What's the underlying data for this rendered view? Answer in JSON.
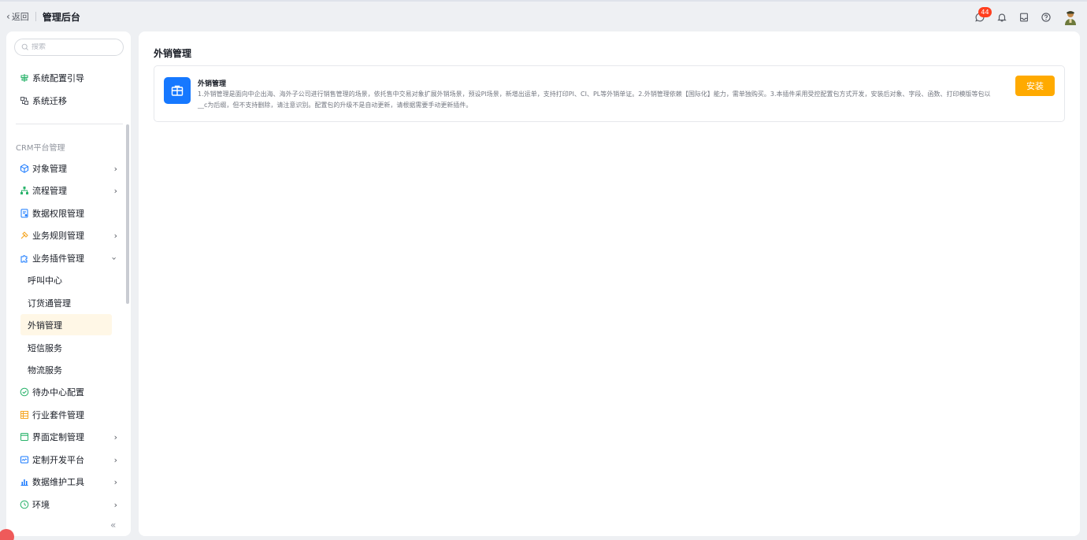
{
  "topbar": {
    "back_label": "返回",
    "title": "管理后台",
    "notification_count": "44",
    "icons": [
      "chat-icon",
      "bell-icon",
      "inbox-icon",
      "help-icon",
      "avatar"
    ]
  },
  "sidebar": {
    "search_placeholder": "搜索",
    "top_items": [
      {
        "label": "系统配置引导",
        "icon": "guide-icon"
      },
      {
        "label": "系统迁移",
        "icon": "migrate-icon"
      }
    ],
    "section_title": "CRM平台管理",
    "items": [
      {
        "label": "对象管理",
        "icon": "object-icon",
        "has_arrow": true
      },
      {
        "label": "流程管理",
        "icon": "flow-icon",
        "has_arrow": true
      },
      {
        "label": "数据权限管理",
        "icon": "data-permission-icon",
        "has_arrow": false
      },
      {
        "label": "业务规则管理",
        "icon": "rule-icon",
        "has_arrow": true
      },
      {
        "label": "业务插件管理",
        "icon": "plugin-icon",
        "has_arrow": true,
        "expanded": true
      }
    ],
    "sub_items": [
      {
        "label": "呼叫中心"
      },
      {
        "label": "订货通管理"
      },
      {
        "label": "外销管理",
        "active": true
      },
      {
        "label": "短信服务"
      },
      {
        "label": "物流服务"
      }
    ],
    "bottom_items": [
      {
        "label": "待办中心配置",
        "icon": "todo-icon",
        "has_arrow": false
      },
      {
        "label": "行业套件管理",
        "icon": "suite-icon",
        "has_arrow": false
      },
      {
        "label": "界面定制管理",
        "icon": "ui-custom-icon",
        "has_arrow": true
      },
      {
        "label": "定制开发平台",
        "icon": "dev-platform-icon",
        "has_arrow": true
      },
      {
        "label": "数据维护工具",
        "icon": "data-tool-icon",
        "has_arrow": true
      },
      {
        "label": "环境",
        "icon": "environment-icon",
        "has_arrow": true
      }
    ],
    "collapse_label": "«"
  },
  "main": {
    "title": "外销管理",
    "card": {
      "title": "外销管理",
      "description": "1.外销管理是面向中企出海、海外子公司进行销售管理的场景，依托售中交易对象扩展外销场景，预设PI场景，新增出运单，支持打印PI、CI、PL等外销单证。2.外销管理依赖【国际化】能力，需单独购买。3.本插件采用受控配置包方式开发，安装后对象、字段、函数、打印模版等包以__c为后缀，但不支持删除，请注意识别。配置包的升级不是自动更新，请根据需要手动更新插件。",
      "install_label": "安装"
    }
  },
  "colors": {
    "accent": "#ffaa00",
    "icon_bg": "#1678ff",
    "badge": "#ff3f1f",
    "active_bg": "#fff7e6"
  }
}
